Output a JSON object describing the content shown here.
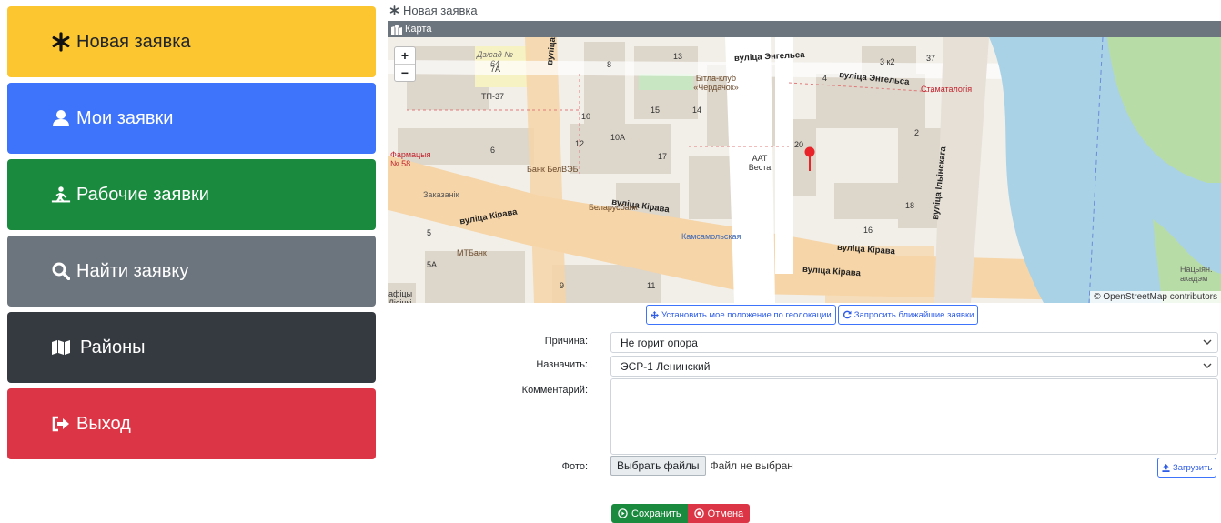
{
  "sidebar": {
    "items": [
      {
        "label": "Новая заявка",
        "icon": "asterisk-icon",
        "color": "#fcc630"
      },
      {
        "label": "Мои заявки",
        "icon": "user-icon",
        "color": "#3e74fb"
      },
      {
        "label": "Рабочие заявки",
        "icon": "worker-icon",
        "color": "#1a8a3f"
      },
      {
        "label": "Найти заявку",
        "icon": "search-icon",
        "color": "#6c757d"
      },
      {
        "label": "Районы",
        "icon": "map-icon",
        "color": "#343a40"
      },
      {
        "label": "Выход",
        "icon": "sign-out-icon",
        "color": "#dc3545"
      }
    ]
  },
  "main": {
    "title": "Новая заявка",
    "map_header": "Карта",
    "map": {
      "zoom_in": "+",
      "zoom_out": "−",
      "attribution": "© OpenStreetMap contributors",
      "labels": {
        "engels1": "вуліца Энгельса",
        "engels2": "вуліца Энгельса",
        "kirava1": "вуліца Кірава",
        "kirava2": "вуліца Кірава",
        "kirava3": "вуліца Кірава",
        "kirava4": "вуліца Кірава",
        "dzimitrava": "вуліца Дзімітрава",
        "ilinskaga": "вуліца Ільінскага",
        "kamsamolskaya": "Камсамольская",
        "stamatalogia": "Стаматалогія",
        "farmacyia": "Фармацыя № 58",
        "bank_belvezb": "Банк БелВЭБ",
        "belarusbank": "Беларусбанк",
        "mtbank": "МТБанк",
        "tp37": "ТП-37",
        "dzsad": "Дз/сад № 64",
        "bitla": "Бітла-клуб «Чердачок»",
        "aat": "ААТ Веста",
        "zakazanik": "Заказанік",
        "naciyanal": "Нацыян. акадэм",
        "afisy": "афіцы Лісіцкі",
        "n7a": "7A",
        "n5a": "5A",
        "n8": "8",
        "n10": "10",
        "n10a": "10A",
        "n12": "12",
        "n13": "13",
        "n14": "14",
        "n15": "15",
        "n16": "16",
        "n17": "17",
        "n18": "18",
        "n20": "20",
        "n37": "37",
        "n3k2": "3 к2",
        "n4": "4",
        "n9": "9",
        "n11": "11",
        "n6": "6",
        "n5": "5",
        "n2": "2"
      }
    },
    "geo_button": "Установить мое положение по геолокации",
    "nearby_button": "Запросить ближайшие заявки",
    "form": {
      "reason_label": "Причина:",
      "reason_value": "Не горит опора",
      "assign_label": "Назначить:",
      "assign_value": "ЭСР-1 Ленинский",
      "comment_label": "Комментарий:",
      "comment_value": "",
      "photo_label": "Фото:",
      "file_button": "Выбрать файлы",
      "file_status": "Файл не выбран",
      "upload_button": "Загрузить",
      "save_button": "Сохранить",
      "cancel_button": "Отмена"
    }
  }
}
